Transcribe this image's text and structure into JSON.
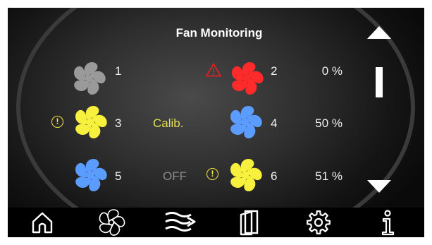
{
  "title": "Fan Monitoring",
  "colors": {
    "gray_fan": "#9a9a9a",
    "red_fan": "#ff2a2a",
    "yellow_fan": "#f7f03c",
    "blue_fan": "#5a9cff",
    "calib_text": "#e6de55",
    "off_text": "#8a8a8a",
    "warning": "#e02020",
    "nav_active": "#5c5c5c"
  },
  "fans": [
    {
      "number": "1",
      "color": "gray"
    },
    {
      "number": "2",
      "color": "red",
      "indicator": "warning-triangle-icon"
    },
    {
      "number": "3",
      "color": "yellow",
      "indicator": "exclamation-circle-icon"
    },
    {
      "number": "4",
      "color": "blue"
    },
    {
      "number": "5",
      "color": "blue"
    },
    {
      "number": "6",
      "color": "yellow",
      "indicator": "exclamation-circle-icon"
    }
  ],
  "rows": [
    {
      "status": "",
      "percent": "0 %"
    },
    {
      "status": "Calib.",
      "percent": "50 %"
    },
    {
      "status": "OFF",
      "percent": "51 %"
    }
  ],
  "scrollbar": {
    "position": 0.2,
    "thumb_fraction": 0.25
  },
  "nav": [
    {
      "icon": "home-icon",
      "active": false
    },
    {
      "icon": "fan-icon",
      "active": true
    },
    {
      "icon": "airflow-icon",
      "active": false
    },
    {
      "icon": "door-icon",
      "active": false
    },
    {
      "icon": "gear-icon",
      "active": false
    },
    {
      "icon": "info-icon",
      "active": false
    }
  ]
}
